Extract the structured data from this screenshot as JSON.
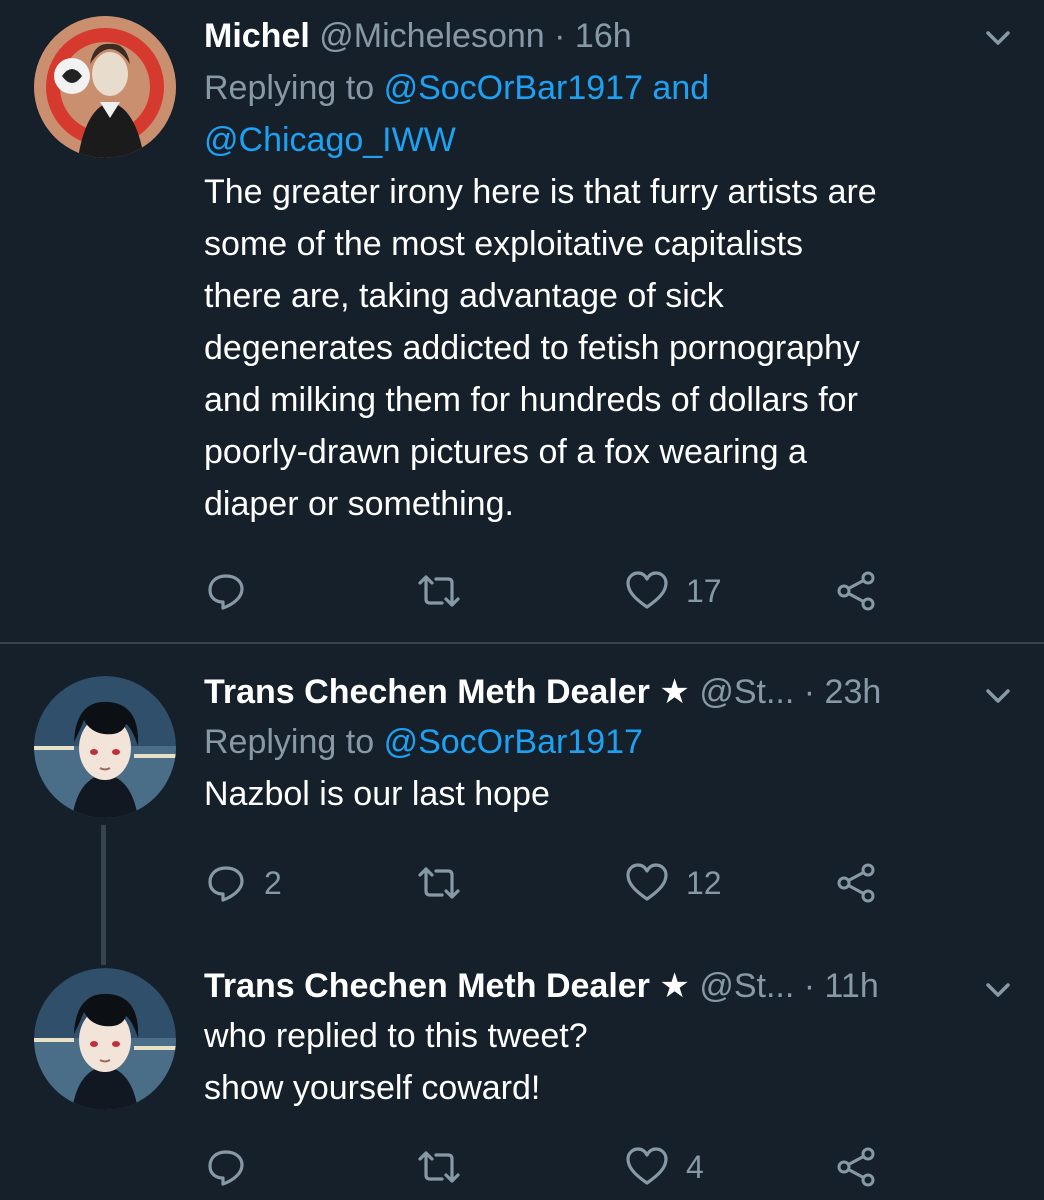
{
  "tweets": [
    {
      "name": "Michel",
      "handle": "@Michelesonn",
      "time": "16h",
      "replying_prefix": "Replying to",
      "replying_to_line1": "@SocOrBar1917 and",
      "replying_to_line2": "@Chicago_IWW",
      "text": "The greater irony here is that furry artists are\nsome of the most exploitative capitalists\nthere are, taking advantage of sick\ndegenerates addicted to fetish pornography\nand milking them for hundreds of dollars for\npoorly-drawn pictures of a fox wearing a\ndiaper or something.",
      "replies": "",
      "retweets": "",
      "likes": "17"
    },
    {
      "name": "Trans Chechen Meth Dealer ★",
      "handle": "@St...",
      "time": "23h",
      "replying_prefix": "Replying to",
      "replying_to_line1": "@SocOrBar1917",
      "text": "Nazbol is our last hope",
      "replies": "2",
      "retweets": "",
      "likes": "12"
    },
    {
      "name": "Trans Chechen Meth Dealer ★",
      "handle": "@St...",
      "time": "11h",
      "text": "who replied to this tweet?\nshow yourself coward!",
      "replies": "",
      "retweets": "",
      "likes": "4"
    }
  ],
  "separator": "·",
  "colors": {
    "background": "#15202b",
    "text": "#ffffff",
    "secondary": "#8899a6",
    "link": "#1da1f2",
    "divider": "#38444d"
  },
  "icons": [
    "reply-icon",
    "retweet-icon",
    "like-icon",
    "share-icon",
    "chevron-down-icon"
  ]
}
